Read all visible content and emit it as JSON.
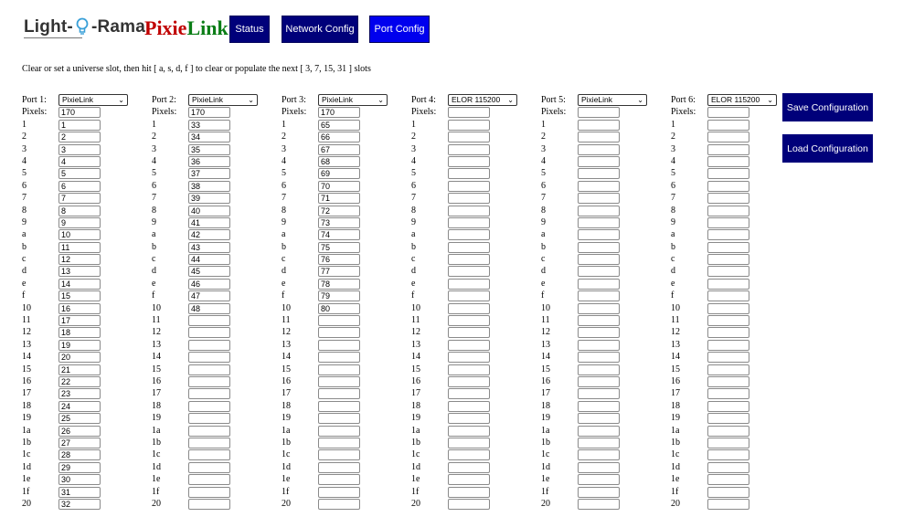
{
  "header": {
    "logo_left": "Light-",
    "logo_right": "-Rama",
    "brand_part1": "Pixie",
    "brand_part2": "Link",
    "nav": {
      "status": "Status",
      "network": "Network Config",
      "port": "Port Config"
    }
  },
  "instructions": "Clear or set a universe slot, then hit [ a, s, d, f ] to clear or populate the next [ 3, 7, 15, 31 ] slots",
  "pixels_label": "Pixels:",
  "row_labels": [
    "1",
    "2",
    "3",
    "4",
    "5",
    "6",
    "7",
    "8",
    "9",
    "a",
    "b",
    "c",
    "d",
    "e",
    "f",
    "10",
    "11",
    "12",
    "13",
    "14",
    "15",
    "16",
    "17",
    "18",
    "19",
    "1a",
    "1b",
    "1c",
    "1d",
    "1e",
    "1f",
    "20"
  ],
  "ports": [
    {
      "label": "Port 1:",
      "type": "PixieLink",
      "pixels": "170",
      "values": [
        "1",
        "2",
        "3",
        "4",
        "5",
        "6",
        "7",
        "8",
        "9",
        "10",
        "11",
        "12",
        "13",
        "14",
        "15",
        "16",
        "17",
        "18",
        "19",
        "20",
        "21",
        "22",
        "23",
        "24",
        "25",
        "26",
        "27",
        "28",
        "29",
        "30",
        "31",
        "32"
      ]
    },
    {
      "label": "Port 2:",
      "type": "PixieLink",
      "pixels": "170",
      "values": [
        "33",
        "34",
        "35",
        "36",
        "37",
        "38",
        "39",
        "40",
        "41",
        "42",
        "43",
        "44",
        "45",
        "46",
        "47",
        "48",
        "",
        "",
        "",
        "",
        "",
        "",
        "",
        "",
        "",
        "",
        "",
        "",
        "",
        "",
        "",
        ""
      ]
    },
    {
      "label": "Port 3:",
      "type": "PixieLink",
      "pixels": "170",
      "values": [
        "65",
        "66",
        "67",
        "68",
        "69",
        "70",
        "71",
        "72",
        "73",
        "74",
        "75",
        "76",
        "77",
        "78",
        "79",
        "80",
        "",
        "",
        "",
        "",
        "",
        "",
        "",
        "",
        "",
        "",
        "",
        "",
        "",
        "",
        "",
        ""
      ]
    },
    {
      "label": "Port 4:",
      "type": "ELOR 115200",
      "pixels": "",
      "values": [
        "",
        "",
        "",
        "",
        "",
        "",
        "",
        "",
        "",
        "",
        "",
        "",
        "",
        "",
        "",
        "",
        "",
        "",
        "",
        "",
        "",
        "",
        "",
        "",
        "",
        "",
        "",
        "",
        "",
        "",
        "",
        ""
      ]
    },
    {
      "label": "Port 5:",
      "type": "PixieLink",
      "pixels": "",
      "values": [
        "",
        "",
        "",
        "",
        "",
        "",
        "",
        "",
        "",
        "",
        "",
        "",
        "",
        "",
        "",
        "",
        "",
        "",
        "",
        "",
        "",
        "",
        "",
        "",
        "",
        "",
        "",
        "",
        "",
        "",
        "",
        ""
      ]
    },
    {
      "label": "Port 6:",
      "type": "ELOR 115200",
      "pixels": "",
      "values": [
        "",
        "",
        "",
        "",
        "",
        "",
        "",
        "",
        "",
        "",
        "",
        "",
        "",
        "",
        "",
        "",
        "",
        "",
        "",
        "",
        "",
        "",
        "",
        "",
        "",
        "",
        "",
        "",
        "",
        "",
        "",
        ""
      ]
    }
  ],
  "actions": {
    "save": "Save Configuration",
    "load": "Load Configuration"
  }
}
